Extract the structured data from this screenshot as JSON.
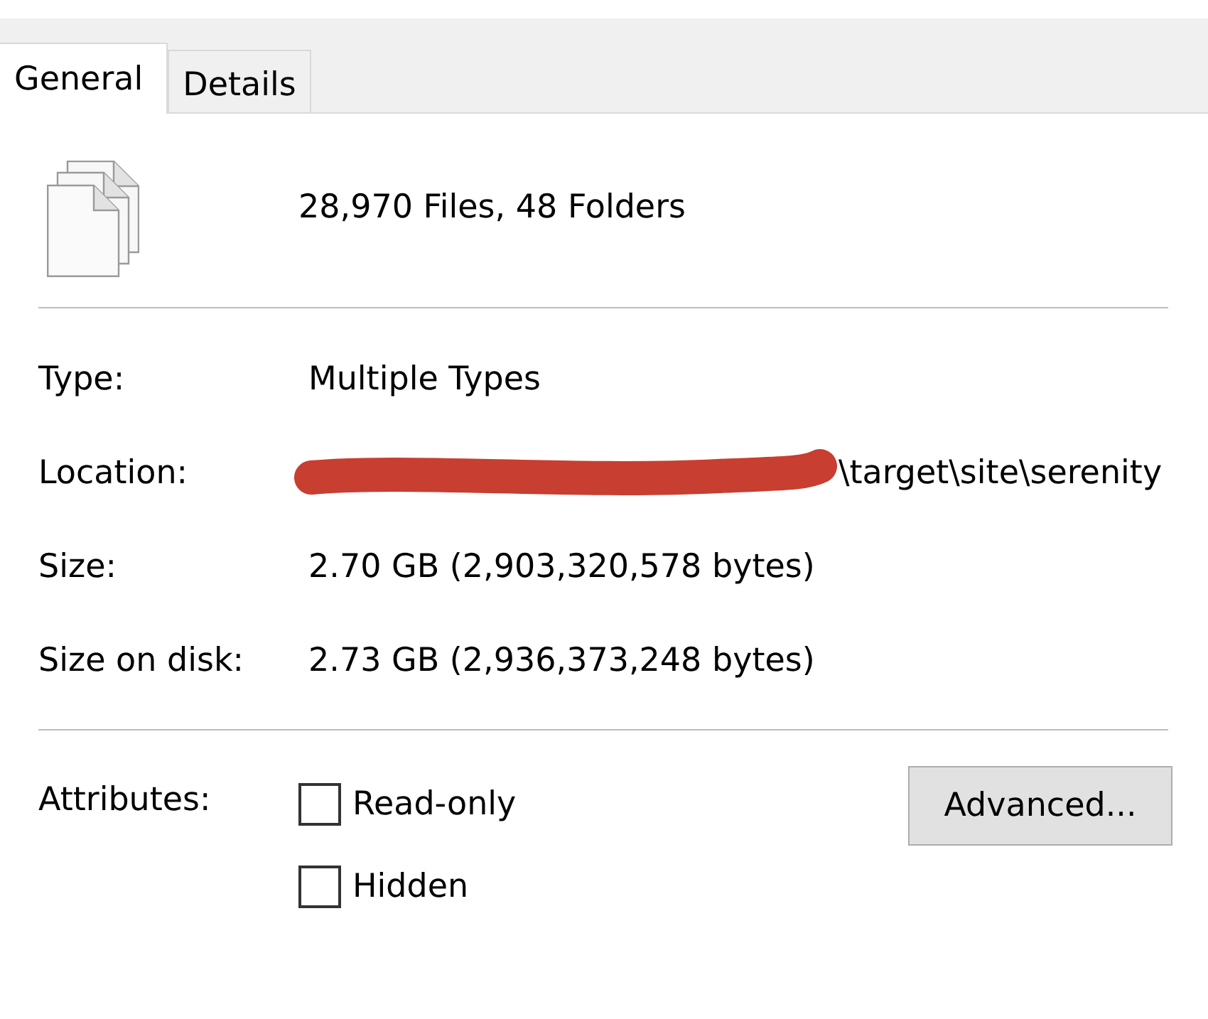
{
  "tabs": [
    {
      "label": "General",
      "selected": true
    },
    {
      "label": "Details",
      "selected": false
    }
  ],
  "summary": {
    "text": "28,970 Files, 48 Folders"
  },
  "properties": [
    {
      "label": "Type:",
      "value": "Multiple Types",
      "redacted": false
    },
    {
      "label": "Location:",
      "value": "\\target\\site\\serenity",
      "redacted": true
    },
    {
      "label": "Size:",
      "value": "2.70 GB (2,903,320,578 bytes)",
      "redacted": false
    },
    {
      "label": "Size on disk:",
      "value": "2.73 GB (2,936,373,248 bytes)",
      "redacted": false
    }
  ],
  "attributes": {
    "label": "Attributes:",
    "options": [
      {
        "label": "Read-only",
        "checked": false
      },
      {
        "label": "Hidden",
        "checked": false
      }
    ],
    "button": "Advanced..."
  }
}
